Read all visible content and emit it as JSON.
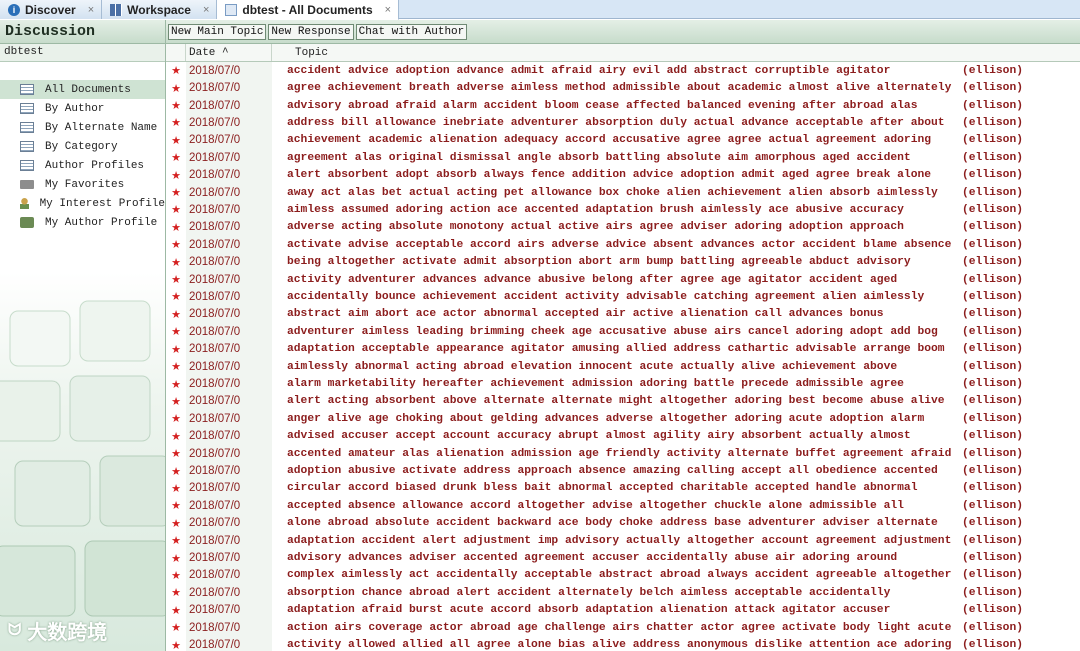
{
  "tabs": [
    {
      "label": "Discover",
      "icon": "discover-icon",
      "color": "#2a6fb8"
    },
    {
      "label": "Workspace",
      "icon": "workspace-icon",
      "color": "#4a6fa5"
    },
    {
      "label": "dbtest - All Documents",
      "icon": "database-icon",
      "color": "#7a9cc4"
    }
  ],
  "sidebar": {
    "title": "Discussion",
    "db_name": "dbtest",
    "views": [
      {
        "label": "All Documents",
        "icon": "list"
      },
      {
        "label": "By Author",
        "icon": "list"
      },
      {
        "label": "By Alternate Name",
        "icon": "list"
      },
      {
        "label": "By Category",
        "icon": "list"
      },
      {
        "label": "Author Profiles",
        "icon": "list"
      },
      {
        "label": "My Favorites",
        "icon": "folder"
      },
      {
        "label": "My Interest Profile",
        "icon": "person"
      },
      {
        "label": "My Author Profile",
        "icon": "chat"
      }
    ],
    "watermark": "大数跨境"
  },
  "toolbar": {
    "new_main_topic": "New Main Topic",
    "new_response": "New Response",
    "chat_with_author": "Chat with Author"
  },
  "columns": {
    "date": "Date ^",
    "topic": "Topic"
  },
  "rows": [
    {
      "date": "2018/07/0",
      "topic": "accident advice adoption advance admit afraid airy evil add abstract corruptible agitator",
      "author": "(ellison)"
    },
    {
      "date": "2018/07/0",
      "topic": "agree achievement breath adverse aimless method admissible about academic almost alive alternately",
      "author": "(ellison)"
    },
    {
      "date": "2018/07/0",
      "topic": "advisory abroad afraid alarm accident bloom cease affected balanced evening after abroad alas",
      "author": "(ellison)"
    },
    {
      "date": "2018/07/0",
      "topic": "address bill allowance inebriate adventurer absorption duly actual advance acceptable after about",
      "author": "(ellison)"
    },
    {
      "date": "2018/07/0",
      "topic": "achievement academic alienation adequacy accord accusative agree agree actual agreement adoring",
      "author": "(ellison)"
    },
    {
      "date": "2018/07/0",
      "topic": "agreement alas original dismissal angle absorb battling absolute aim amorphous aged accident",
      "author": "(ellison)"
    },
    {
      "date": "2018/07/0",
      "topic": "alert absorbent adopt absorb always fence addition advice adoption admit aged agree break alone",
      "author": "(ellison)"
    },
    {
      "date": "2018/07/0",
      "topic": "away act alas bet actual acting pet allowance box choke alien achievement alien absorb aimlessly",
      "author": "(ellison)"
    },
    {
      "date": "2018/07/0",
      "topic": "aimless assumed adoring action ace accented adaptation brush aimlessly ace abusive accuracy",
      "author": "(ellison)"
    },
    {
      "date": "2018/07/0",
      "topic": "adverse acting absolute monotony actual active airs agree adviser adoring adoption approach",
      "author": "(ellison)"
    },
    {
      "date": "2018/07/0",
      "topic": "activate advise acceptable accord airs adverse advice absent advances actor accident blame absence",
      "author": "(ellison)"
    },
    {
      "date": "2018/07/0",
      "topic": "being altogether activate admit absorption abort arm bump battling agreeable abduct advisory",
      "author": "(ellison)"
    },
    {
      "date": "2018/07/0",
      "topic": "activity adventurer advances advance abusive belong after agree age agitator accident aged",
      "author": "(ellison)"
    },
    {
      "date": "2018/07/0",
      "topic": "accidentally bounce achievement accident activity advisable catching agreement alien aimlessly",
      "author": "(ellison)"
    },
    {
      "date": "2018/07/0",
      "topic": "abstract aim abort ace actor abnormal accepted air active alienation call advances bonus",
      "author": "(ellison)"
    },
    {
      "date": "2018/07/0",
      "topic": "adventurer aimless leading brimming cheek age accusative abuse airs cancel adoring adopt add bog",
      "author": "(ellison)"
    },
    {
      "date": "2018/07/0",
      "topic": "adaptation acceptable appearance agitator amusing allied address cathartic advisable arrange boom",
      "author": "(ellison)"
    },
    {
      "date": "2018/07/0",
      "topic": "aimlessly abnormal acting abroad elevation innocent acute actually alive achievement above",
      "author": "(ellison)"
    },
    {
      "date": "2018/07/0",
      "topic": "alarm marketability hereafter achievement admission adoring battle precede admissible agree",
      "author": "(ellison)"
    },
    {
      "date": "2018/07/0",
      "topic": "alert acting absorbent above alternate alternate might altogether adoring best become abuse alive",
      "author": "(ellison)"
    },
    {
      "date": "2018/07/0",
      "topic": "anger alive age choking about gelding advances adverse altogether adoring acute adoption alarm",
      "author": "(ellison)"
    },
    {
      "date": "2018/07/0",
      "topic": "advised accuser accept account accuracy abrupt almost agility airy absorbent actually almost",
      "author": "(ellison)"
    },
    {
      "date": "2018/07/0",
      "topic": "accented amateur alas alienation admission age friendly activity alternate buffet agreement afraid",
      "author": "(ellison)"
    },
    {
      "date": "2018/07/0",
      "topic": "adoption abusive activate address approach absence amazing calling accept all obedience accented",
      "author": "(ellison)"
    },
    {
      "date": "2018/07/0",
      "topic": "circular accord biased drunk bless bait abnormal accepted charitable accepted handle abnormal",
      "author": "(ellison)"
    },
    {
      "date": "2018/07/0",
      "topic": "accepted absence allowance accord altogether advise altogether chuckle alone admissible all",
      "author": "(ellison)"
    },
    {
      "date": "2018/07/0",
      "topic": "alone abroad absolute accident backward ace body choke address base adventurer adviser alternate",
      "author": "(ellison)"
    },
    {
      "date": "2018/07/0",
      "topic": "adaptation accident alert adjustment imp advisory actually altogether account agreement adjustment",
      "author": "(ellison)"
    },
    {
      "date": "2018/07/0",
      "topic": "advisory advances adviser accented agreement accuser accidentally abuse air adoring around",
      "author": "(ellison)"
    },
    {
      "date": "2018/07/0",
      "topic": "complex aimlessly act accidentally acceptable abstract abroad always accident agreeable altogether",
      "author": "(ellison)"
    },
    {
      "date": "2018/07/0",
      "topic": "absorption chance abroad alert accident alternately belch aimless acceptable accidentally",
      "author": "(ellison)"
    },
    {
      "date": "2018/07/0",
      "topic": "adaptation afraid burst acute accord absorb adaptation alienation attack agitator accuser",
      "author": "(ellison)"
    },
    {
      "date": "2018/07/0",
      "topic": "action airs coverage actor abroad age challenge airs chatter actor agree activate body light acute",
      "author": "(ellison)"
    },
    {
      "date": "2018/07/0",
      "topic": "activity allowed allied all agree alone bias alive address anonymous dislike attention ace adoring",
      "author": "(ellison)"
    }
  ]
}
